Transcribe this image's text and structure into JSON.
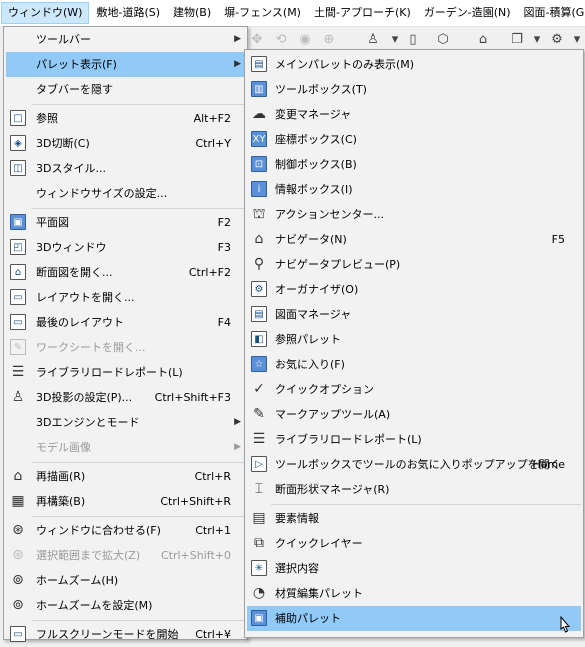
{
  "menubar": {
    "items": [
      {
        "label": "ウィンドウ(W)",
        "active": true
      },
      {
        "label": "敷地-道路(S)"
      },
      {
        "label": "建物(B)"
      },
      {
        "label": "塀-フェンス(M)"
      },
      {
        "label": "土間-アプローチ(K)"
      },
      {
        "label": "ガーデン-造園(N)"
      },
      {
        "label": "図面-積算(G)"
      }
    ],
    "overflow": "❮"
  },
  "toolbar": {
    "icons": [
      "pan-icon",
      "orbit-icon",
      "eye-icon",
      "target-icon",
      "person-icon",
      "dropdown-icon",
      "box-icon",
      "cube-icon",
      "navigator-icon",
      "layer-icon",
      "dropdown-icon",
      "settings-icon",
      "dropdown-icon"
    ]
  },
  "main_menu": {
    "items": [
      {
        "label": "ツールバー",
        "arrow": "▶"
      },
      {
        "label": "パレット表示(F)",
        "arrow": "▶",
        "highlight": true
      },
      {
        "label": "タブバーを隠す"
      },
      {
        "label": "参照",
        "shortcut": "Alt+F2",
        "icon": "reference-icon"
      },
      {
        "label": "3D切断(C)",
        "shortcut": "Ctrl+Y",
        "icon": "3d-cut-icon"
      },
      {
        "label": "3Dスタイル...",
        "icon": "3d-style-icon"
      },
      {
        "label": "ウィンドウサイズの設定..."
      },
      {
        "label": "平面図",
        "shortcut": "F2",
        "icon": "floor-plan-icon",
        "selected": true
      },
      {
        "label": "3Dウィンドウ",
        "shortcut": "F3",
        "icon": "3d-window-icon"
      },
      {
        "label": "断面図を開く...",
        "shortcut": "Ctrl+F2",
        "icon": "section-icon"
      },
      {
        "label": "レイアウトを開く...",
        "icon": "layout-icon"
      },
      {
        "label": "最後のレイアウト",
        "shortcut": "F4",
        "icon": "last-layout-icon"
      },
      {
        "label": "ワークシートを開く...",
        "icon": "worksheet-icon",
        "disabled": true
      },
      {
        "label": "ライブラリロードレポート(L)",
        "icon": "library-report-icon"
      },
      {
        "label": "3D投影の設定(P)...",
        "shortcut": "Ctrl+Shift+F3",
        "icon": "3d-projection-icon"
      },
      {
        "label": "3Dエンジンとモード",
        "arrow": "▶"
      },
      {
        "label": "モデル画像",
        "arrow": "▶",
        "disabled": true
      },
      {
        "label": "再描画(R)",
        "shortcut": "Ctrl+R",
        "icon": "redraw-icon"
      },
      {
        "label": "再構築(B)",
        "shortcut": "Ctrl+Shift+R",
        "icon": "rebuild-icon"
      },
      {
        "label": "ウィンドウに合わせる(F)",
        "shortcut": "Ctrl+1",
        "icon": "fit-window-icon"
      },
      {
        "label": "選択範囲まで拡大(Z)",
        "shortcut": "Ctrl+Shift+0",
        "icon": "zoom-selection-icon",
        "disabled": true
      },
      {
        "label": "ホームズーム(H)",
        "icon": "home-zoom-icon"
      },
      {
        "label": "ホームズームを設定(M)",
        "icon": "set-home-zoom-icon"
      },
      {
        "label": "フルスクリーンモードを開始",
        "shortcut": "Ctrl+¥",
        "icon": "fullscreen-icon"
      }
    ]
  },
  "sub_menu": {
    "items": [
      {
        "label": "メインパレットのみ表示(M)",
        "icon": "main-palette-icon"
      },
      {
        "label": "ツールボックス(T)",
        "icon": "toolbox-icon",
        "selected": true
      },
      {
        "label": "変更マネージャ",
        "icon": "change-manager-icon"
      },
      {
        "label": "座標ボックス(C)",
        "icon": "coordinate-box-icon",
        "selected": true
      },
      {
        "label": "制御ボックス(B)",
        "icon": "control-box-icon",
        "selected": true
      },
      {
        "label": "情報ボックス(I)",
        "icon": "info-box-icon",
        "selected": true
      },
      {
        "label": "アクションセンター...",
        "icon": "action-center-icon"
      },
      {
        "label": "ナビゲータ(N)",
        "shortcut": "F5",
        "icon": "navigator-icon"
      },
      {
        "label": "ナビゲータプレビュー(P)",
        "icon": "navigator-preview-icon"
      },
      {
        "label": "オーガナイザ(O)",
        "icon": "organizer-icon"
      },
      {
        "label": "図面マネージャ",
        "icon": "drawing-manager-icon"
      },
      {
        "label": "参照パレット",
        "icon": "reference-palette-icon"
      },
      {
        "label": "お気に入り(F)",
        "icon": "star-icon",
        "selected": true
      },
      {
        "label": "クイックオプション",
        "icon": "quick-options-icon"
      },
      {
        "label": "マークアップツール(A)",
        "icon": "markup-icon"
      },
      {
        "label": "ライブラリロードレポート(L)",
        "icon": "library-report-icon"
      },
      {
        "label": "ツールボックスでツールのお気に入りポップアップを開く",
        "shortcut": "Home",
        "icon": "play-icon"
      },
      {
        "label": "断面形状マネージャ(R)",
        "icon": "profile-manager-icon"
      },
      {
        "label": "要素情報",
        "icon": "element-info-icon"
      },
      {
        "label": "クイックレイヤー",
        "icon": "quick-layer-icon"
      },
      {
        "label": "選択内容",
        "icon": "selection-icon"
      },
      {
        "label": "材質編集パレット",
        "icon": "material-icon"
      },
      {
        "label": "補助パレット",
        "icon": "helper-palette-icon",
        "highlight": true
      }
    ]
  }
}
